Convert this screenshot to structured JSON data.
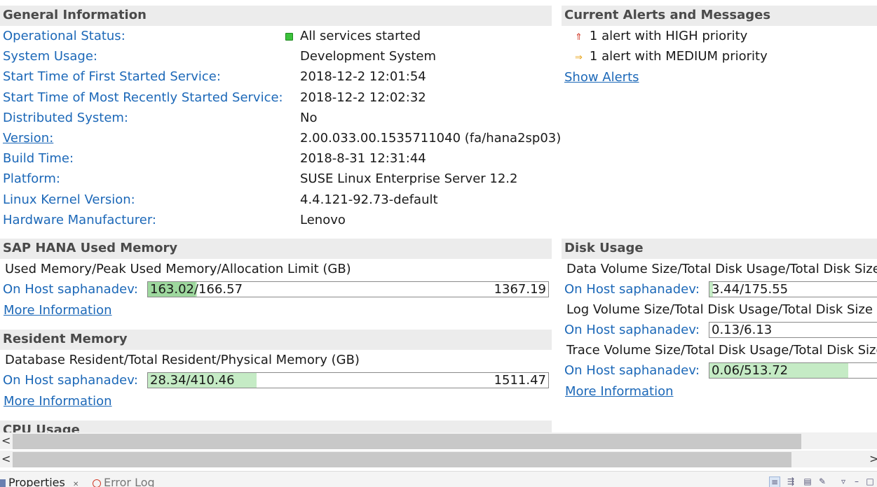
{
  "general": {
    "title": "General Information",
    "rows": [
      {
        "label": "Operational Status:",
        "value": "All services started"
      },
      {
        "label": "System Usage:",
        "value": "Development System"
      },
      {
        "label": "Start Time of First Started Service:",
        "value": "2018-12-2 12:01:54"
      },
      {
        "label": "Start Time of Most Recently Started Service:",
        "value": "2018-12-2 12:02:32"
      },
      {
        "label": "Distributed System:",
        "value": "No"
      },
      {
        "label": "Version:",
        "value": "2.00.033.00.1535711040 (fa/hana2sp03)"
      },
      {
        "label": "Build Time:",
        "value": "2018-8-31 12:31:44"
      },
      {
        "label": "Platform:",
        "value": "SUSE Linux Enterprise Server 12.2"
      },
      {
        "label": "Linux Kernel Version:",
        "value": "4.4.121-92.73-default"
      },
      {
        "label": "Hardware Manufacturer:",
        "value": "Lenovo"
      }
    ]
  },
  "alerts": {
    "title": "Current Alerts and Messages",
    "items": [
      {
        "text": "1 alert with HIGH priority",
        "icon": "arrow-up-red-icon",
        "color": "#d23c2a"
      },
      {
        "text": "1 alert with MEDIUM priority",
        "icon": "arrow-right-orange-icon",
        "color": "#e8a317"
      }
    ],
    "show_link": "Show Alerts"
  },
  "used_memory": {
    "title": "SAP HANA Used Memory",
    "subtitle": "Used Memory/Peak Used Memory/Allocation Limit (GB)",
    "host_label": "On Host saphanadev:",
    "used": "163.02",
    "peak_text": "/166.57",
    "limit": "1367.19",
    "used_fraction": 0.119,
    "peak_fraction": 0.122,
    "more_link": "More Information"
  },
  "resident_memory": {
    "title": "Resident Memory",
    "subtitle": "Database Resident/Total Resident/Physical Memory (GB)",
    "host_label": "On Host saphanadev:",
    "bar_text": "28.34/410.46",
    "physical": "1511.47",
    "resident_fraction": 0.272,
    "more_link": "More Information"
  },
  "cpu_usage": {
    "title": "CPU Usage"
  },
  "disk_usage": {
    "title": "Disk Usage",
    "groups": [
      {
        "subtitle": "Data Volume Size/Total Disk Usage/Total Disk Size (",
        "host_label": "On Host saphanadev:",
        "bar_text": "3.44/175.55",
        "fraction": 0.02
      },
      {
        "subtitle": "Log Volume Size/Total Disk Usage/Total Disk Size (G",
        "host_label": "On Host saphanadev:",
        "bar_text": "0.13/6.13",
        "fraction": 0.0
      },
      {
        "subtitle": "Trace Volume Size/Total Disk Usage/Total Disk Size",
        "host_label": "On Host saphanadev:",
        "bar_text": "0.06/513.72",
        "fraction": 0.8
      }
    ],
    "more_link": "More Information"
  },
  "bottom_tabs": {
    "properties": "Properties",
    "error_log": "Error Log",
    "close_symbol": "✕"
  },
  "scroll": {
    "left_arrow": "<",
    "right_arrow": ">"
  }
}
